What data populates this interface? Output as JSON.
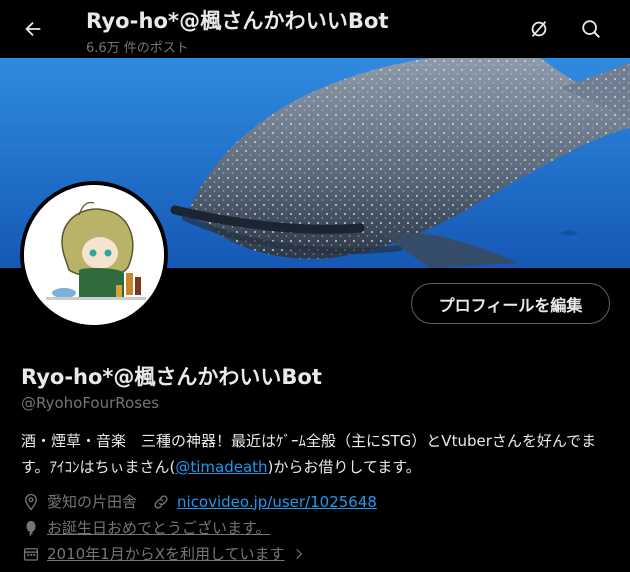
{
  "header": {
    "title": "Ryo-ho*@楓さんかわいいBot",
    "post_count": "6.6万 件のポスト"
  },
  "icons": {
    "back": "back-arrow-icon",
    "mute": "muted-icon",
    "search": "search-icon"
  },
  "profile": {
    "edit_button": "プロフィールを編集",
    "display_name": "Ryo-ho*@楓さんかわいいBot",
    "handle": "@RyohoFourRoses",
    "bio_part1": "酒・煙草・音楽　三種の神器！最近はｹﾞｰﾑ全般（主にSTG）とVtuberさんを好んでます。ｱｲｺﾝはちぃまさん(",
    "bio_link": "@timadeath",
    "bio_part2": ")からお借りしてます。",
    "location": "愛知の片田舎",
    "website": "nicovideo.jp/user/1025648",
    "birthday_prompt": "お誕生日おめでとうございます。",
    "joined": "2010年1月からXを利用しています"
  },
  "colors": {
    "background": "#000000",
    "text": "#e7e9ea",
    "secondary_text": "#71767b",
    "link": "#1d9bf0",
    "banner_water": "#1f6fc7"
  }
}
